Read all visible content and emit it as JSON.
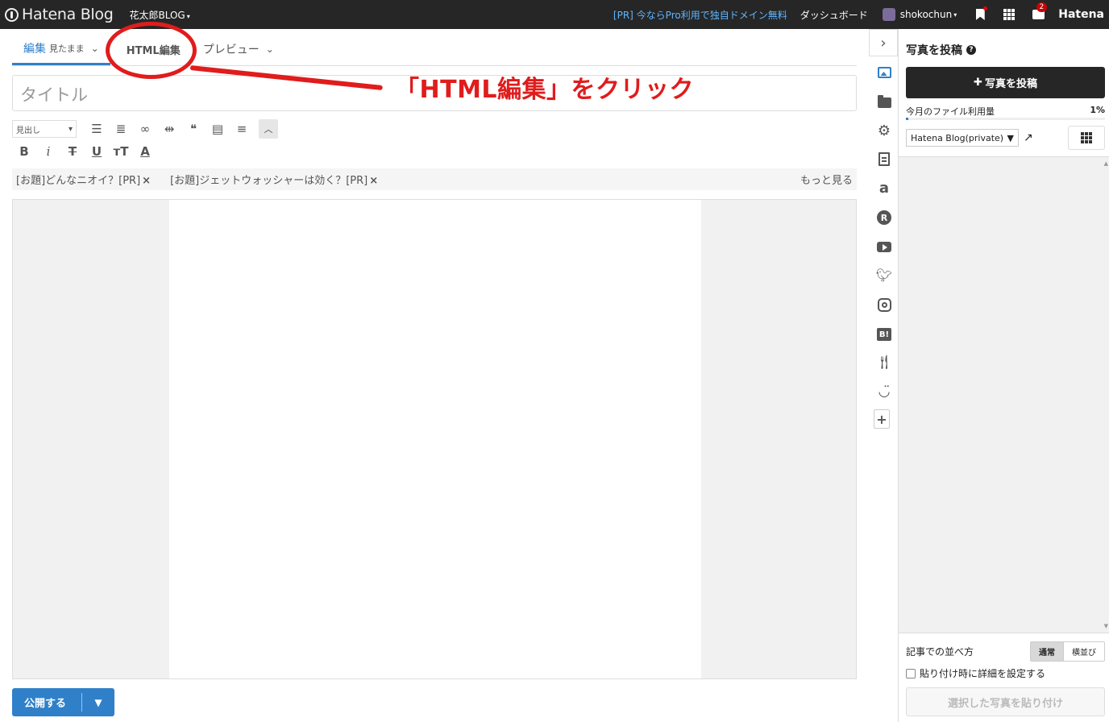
{
  "topbar": {
    "logo": "Hatena Blog",
    "blog_name": "花太郎BLOG",
    "pr_link": "[PR] 今ならPro利用で独自ドメイン無料",
    "dashboard": "ダッシュボード",
    "user": "shokochun",
    "notif_count": "2",
    "brand": "Hatena"
  },
  "editor": {
    "tab_edit": "編集",
    "tab_edit_mode": "見たまま",
    "tab_html": "HTML編集",
    "tab_preview": "プレビュー",
    "title_placeholder": "タイトル",
    "heading_select": "見出し",
    "topics": [
      {
        "label": "[お題]どんなニオイ？[PR]"
      },
      {
        "label": "[お題]ジェットウォッシャーは効く？[PR]"
      }
    ],
    "more_topics": "もっと見る",
    "publish": "公開する"
  },
  "annotation": {
    "text": "「HTML編集」をクリック",
    "color": "#e01c1c"
  },
  "panel": {
    "title": "写真を投稿",
    "upload_button": "写真を投稿",
    "usage_label": "今月のファイル利用量",
    "usage_percent": "1%",
    "usage_fraction": 0.01,
    "album": "Hatena Blog(private)",
    "arrange_label": "記事での並べ方",
    "arrange_normal": "通常",
    "arrange_side": "横並び",
    "detail_checkbox": "貼り付け時に詳細を設定する",
    "paste_button": "選択した写真を貼り付け"
  },
  "colors": {
    "accent": "#2f80c9",
    "topbar": "#262626"
  }
}
